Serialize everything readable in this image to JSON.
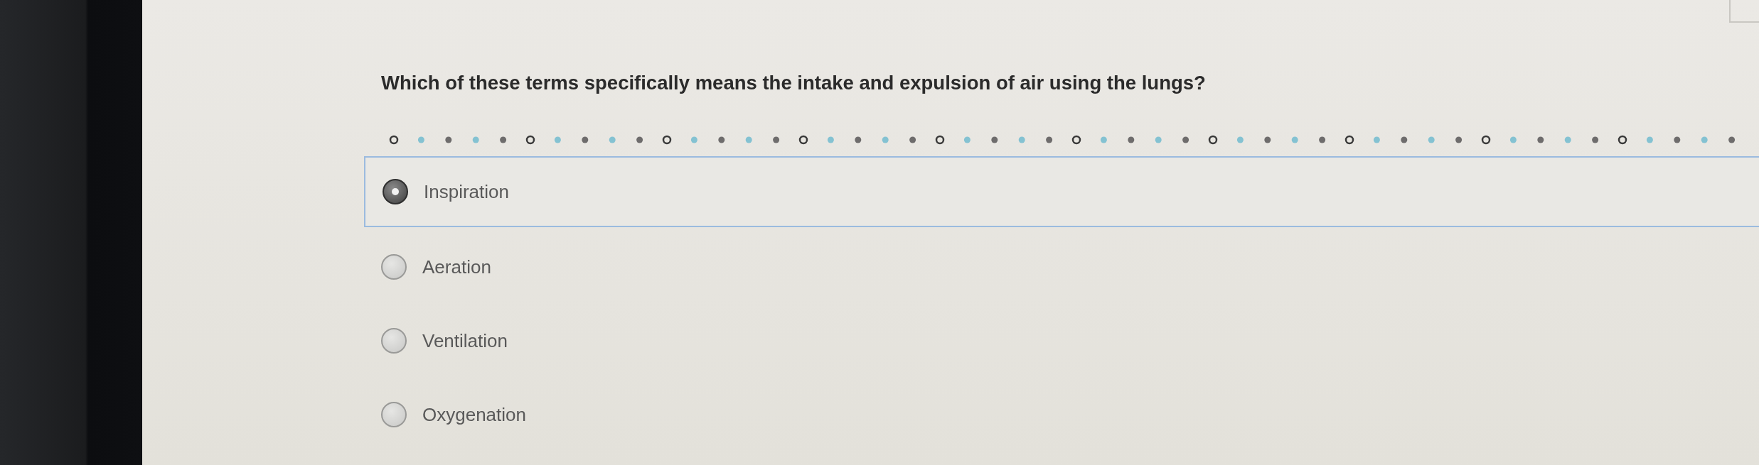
{
  "question": {
    "text": "Which of these terms specifically means the intake and expulsion of air using the lungs?"
  },
  "options": [
    {
      "label": "Inspiration",
      "selected": true
    },
    {
      "label": "Aeration",
      "selected": false
    },
    {
      "label": "Ventilation",
      "selected": false
    },
    {
      "label": "Oxygenation",
      "selected": false
    }
  ]
}
